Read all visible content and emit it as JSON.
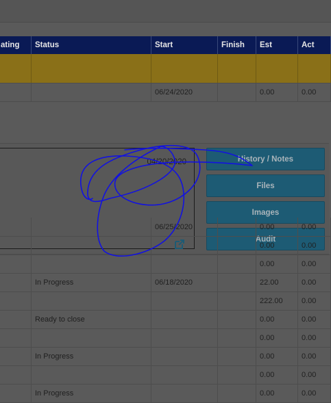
{
  "table": {
    "columns": [
      "ating",
      "Status",
      "Start",
      "Finish",
      "Est",
      "Act"
    ],
    "rows_before": [
      {
        "status": "",
        "start": "06/24/2020",
        "finish": "",
        "est": "0.00",
        "act": "0.00"
      }
    ],
    "rows_after": [
      {
        "status": "",
        "start": "06/25/2020",
        "finish": "",
        "est": "0.00",
        "act": "0.00"
      },
      {
        "status": "",
        "start": "",
        "finish": "",
        "est": "0.00",
        "act": "0.00"
      },
      {
        "status": "",
        "start": "",
        "finish": "",
        "est": "0.00",
        "act": "0.00"
      },
      {
        "status": "In Progress",
        "start": "06/18/2020",
        "finish": "",
        "est": "22.00",
        "act": "0.00"
      },
      {
        "status": "",
        "start": "",
        "finish": "",
        "est": "222.00",
        "act": "0.00"
      },
      {
        "status": "Ready to close",
        "start": "",
        "finish": "",
        "est": "0.00",
        "act": "0.00"
      },
      {
        "status": "",
        "start": "",
        "finish": "",
        "est": "0.00",
        "act": "0.00"
      },
      {
        "status": "In Progress",
        "start": "",
        "finish": "",
        "est": "0.00",
        "act": "0.00"
      },
      {
        "status": "",
        "start": "",
        "finish": "",
        "est": "0.00",
        "act": "0.00"
      },
      {
        "status": "In Progress",
        "start": "",
        "finish": "",
        "est": "0.00",
        "act": "0.00"
      }
    ]
  },
  "detail": {
    "date": "04/20/2020",
    "link_icon": "external-link-icon"
  },
  "actions": {
    "history": "History / Notes",
    "files": "Files",
    "images": "Images",
    "audit": "Audit"
  },
  "colors": {
    "header_bg": "#0a1a55",
    "highlight_row": "#8a7018",
    "button_bg": "#1d5b74",
    "scribble": "#1212e0"
  }
}
